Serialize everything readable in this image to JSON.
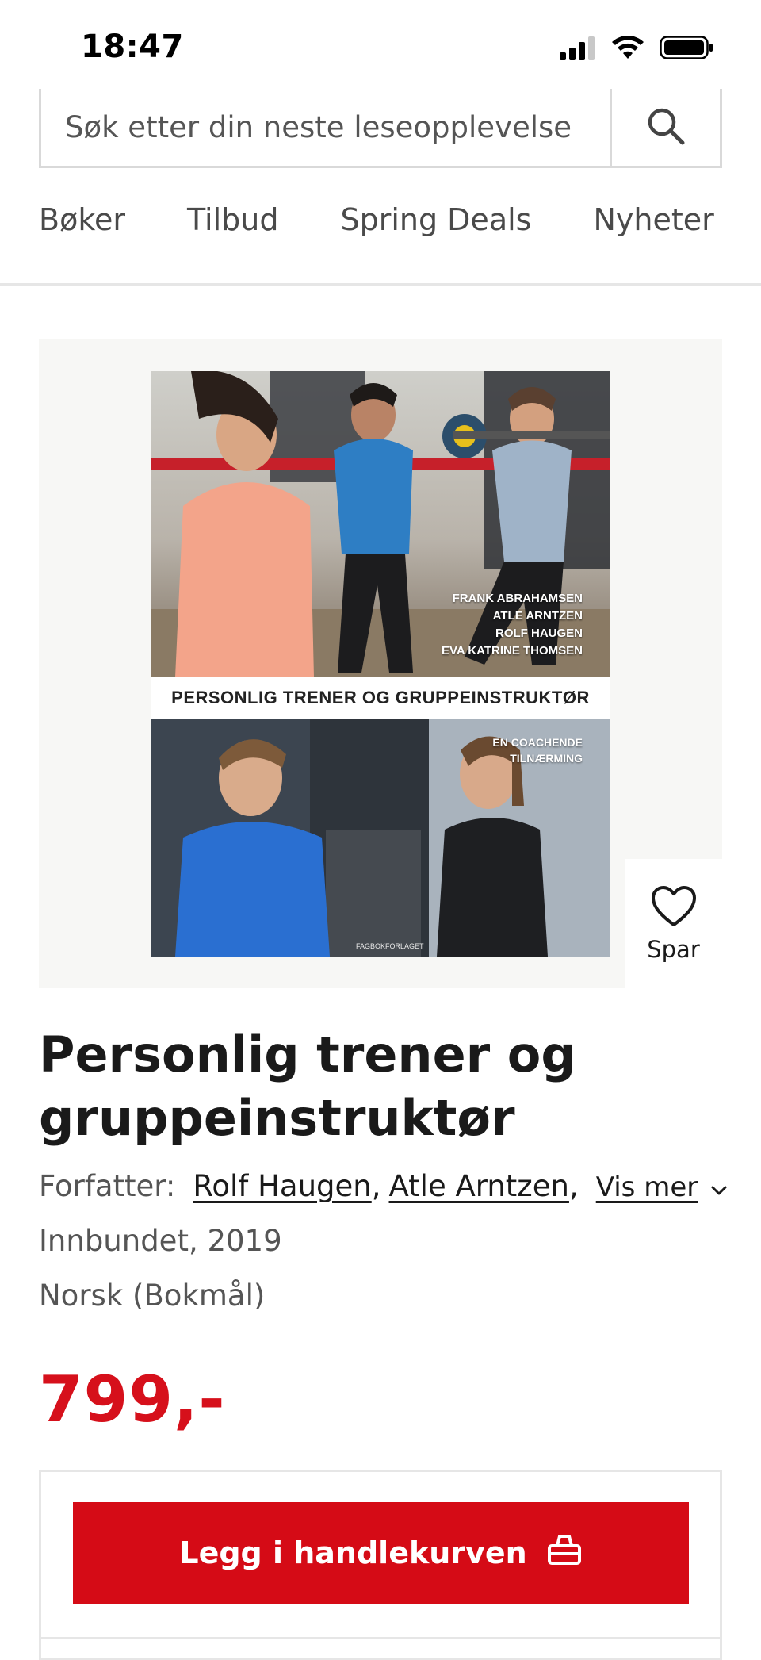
{
  "status_bar": {
    "time": "18:47",
    "icons": [
      "signal-icon",
      "wifi-icon",
      "battery-icon"
    ]
  },
  "search": {
    "placeholder": "Søk etter din neste leseopplevelse",
    "button_icon": "search-icon"
  },
  "nav": {
    "items": [
      "Bøker",
      "Tilbud",
      "Spring Deals",
      "Nyheter"
    ]
  },
  "cover": {
    "authors": [
      "FRANK ABRAHAMSEN",
      "ATLE ARNTZEN",
      "ROLF HAUGEN",
      "EVA KATRINE THOMSEN"
    ],
    "title": "PERSONLIG TRENER OG GRUPPEINSTRUKTØR",
    "subtitle_line1": "EN COACHENDE",
    "subtitle_line2": "TILNÆRMING",
    "publisher": "FAGBOKFORLAGET"
  },
  "save": {
    "label": "Spar",
    "icon": "heart-icon"
  },
  "product": {
    "title": "Personlig trener og gruppeinstruktør",
    "author_label": "Forfatter:",
    "authors": [
      "Rolf Haugen",
      "Atle Arntzen"
    ],
    "show_more": "Vis mer",
    "format": "Innbundet, 2019",
    "language": "Norsk (Bokmål)",
    "price": "799,-"
  },
  "cart": {
    "button_label": "Legg i handlekurven",
    "icon": "basket-icon"
  },
  "colors": {
    "accent": "#d50b16",
    "price": "#d6101b",
    "muted_text": "#555555",
    "panel_bg": "#f7f7f5"
  }
}
